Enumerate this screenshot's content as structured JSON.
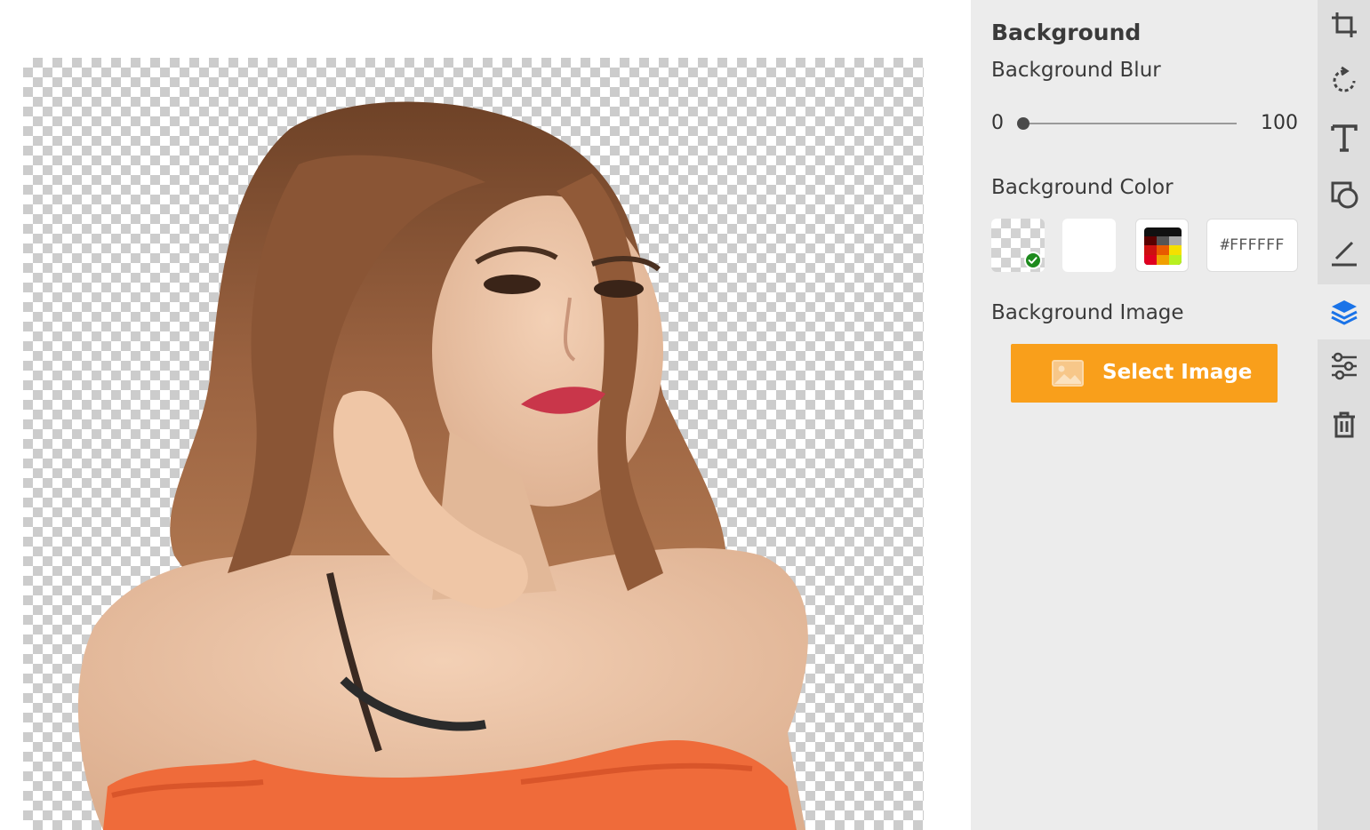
{
  "panel": {
    "title": "Background",
    "blur": {
      "label": "Background Blur",
      "min_label": "0",
      "max_label": "100",
      "value": 0
    },
    "color": {
      "label": "Background Color",
      "swatches": [
        {
          "name": "transparent",
          "selected": true
        },
        {
          "name": "white",
          "value": "#FFFFFF",
          "selected": false
        },
        {
          "name": "color-picker",
          "selected": false
        }
      ],
      "hex_value": "#FFFFFF"
    },
    "image": {
      "label": "Background Image",
      "button_label": "Select Image",
      "button_color": "#f99f1b"
    }
  },
  "toolbar": {
    "tools": [
      {
        "name": "crop-icon"
      },
      {
        "name": "rotate-icon"
      },
      {
        "name": "text-icon"
      },
      {
        "name": "shapes-icon"
      },
      {
        "name": "draw-icon"
      },
      {
        "name": "layers-icon",
        "active": true
      },
      {
        "name": "adjust-icon"
      },
      {
        "name": "delete-icon"
      }
    ],
    "accent": "#1a73e8"
  }
}
